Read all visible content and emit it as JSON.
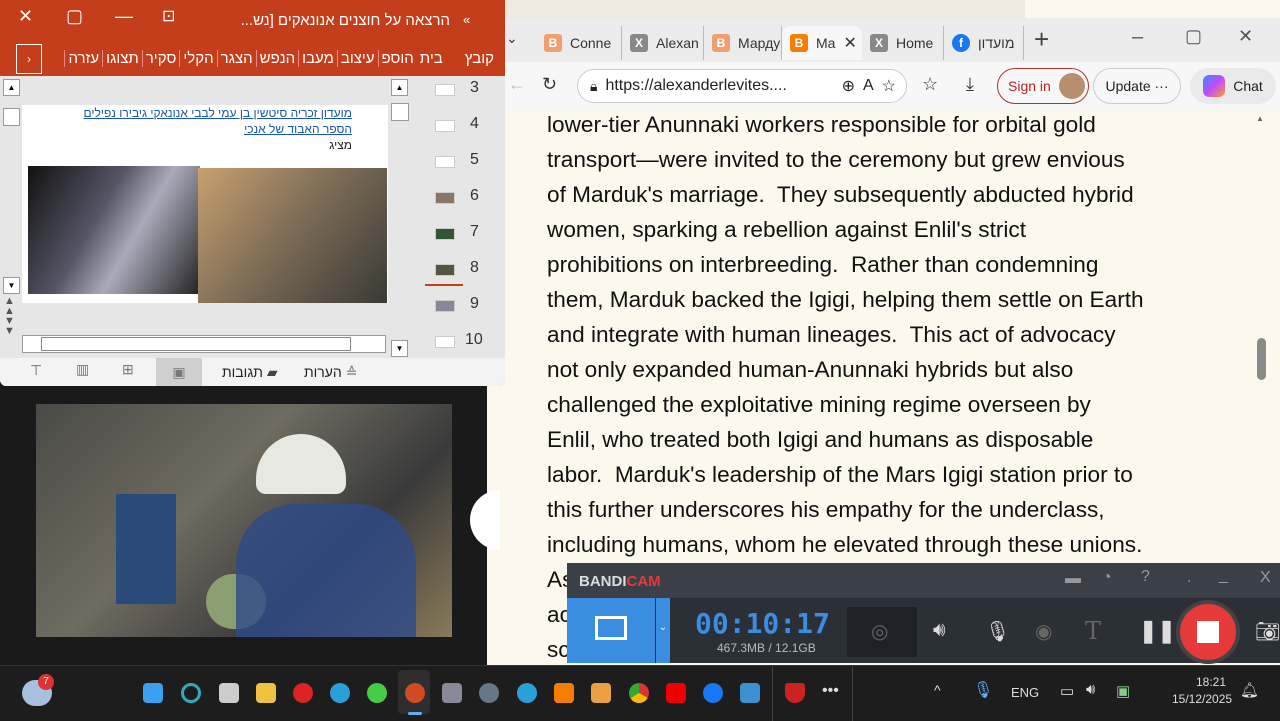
{
  "browser": {
    "tabs": [
      {
        "label": "Conne",
        "icon": "blogger-icon"
      },
      {
        "label": "Alexan",
        "icon": "x-icon"
      },
      {
        "label": "Марду",
        "icon": "blogger-icon"
      },
      {
        "label": "Ma",
        "icon": "blogger-icon",
        "active": true
      },
      {
        "label": "Home",
        "icon": "x-icon"
      },
      {
        "label": "מועדון",
        "icon": "facebook-icon"
      }
    ],
    "url": "https://alexanderlevites....",
    "sign_in": "Sign in",
    "update": "Update",
    "update_more": "···",
    "chat": "Chat",
    "lines": [
      "lower-tier Anunnaki workers responsible for orbital gold",
      "transport—were invited to the ceremony but grew envious",
      "of Marduk's marriage.  They subsequently abducted hybrid",
      "women, sparking a rebellion against Enlil's strict",
      "prohibitions on interbreeding.  Rather than condemning",
      "them, Marduk backed the Igigi, helping them settle on Earth",
      "and integrate with human lineages.  This act of advocacy",
      "not only expanded human-Anunnaki hybrids but also",
      "challenged the exploitative mining regime overseen by",
      "Enlil, who treated both Igigi and humans as disposable",
      "labor.  Marduk's leadership of the Mars Igigi station prior to",
      "this further underscores his empathy for the underclass,",
      "including humans, whom he elevated through these unions.",
      "As",
      "ac",
      "sc"
    ]
  },
  "ppt": {
    "title": "הרצאה על חוצנים אנונאקים [נש...",
    "ribbon": [
      "קובץ",
      "בית",
      "הוספ",
      "עיצוב",
      "מעבו",
      "הנפש",
      "הצגר",
      "הקלי",
      "סקיר",
      "תצוגו",
      "עזרה"
    ],
    "slide_link": "מועדון זכריה סיטשין בן עמי לבבי אנונאקי גיבירו נפילים הספר האבוד של אנכי",
    "slide_text": "מציג",
    "slide_numbers": [
      "3",
      "4",
      "5",
      "6",
      "7",
      "8",
      "9",
      "10"
    ],
    "comments": "תגובות",
    "notes": "הערות"
  },
  "bandicam": {
    "logo_a": "BANDI",
    "logo_b": "CAM",
    "timer": "00:10:17",
    "size": "467.3MB / 12.1GB",
    "accent": "#3a8de0",
    "stop_color": "#e5393a"
  },
  "taskbar": {
    "weather_badge": "7",
    "lang": "ENG",
    "time": "18:21",
    "date": "15/12/2025"
  }
}
